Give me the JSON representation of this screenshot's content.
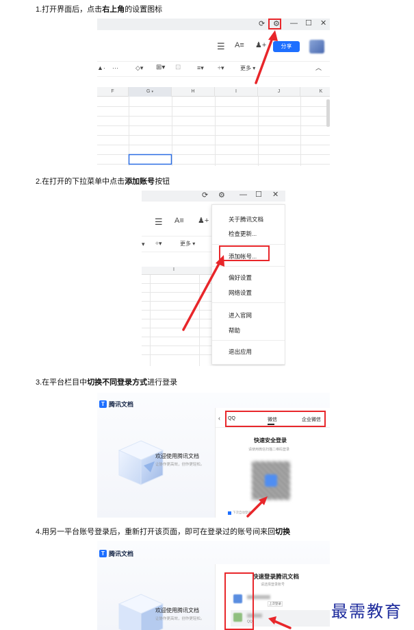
{
  "steps": [
    {
      "pre": "1.打开界面后，点击",
      "bold": "右上角",
      "post": "的设置图标"
    },
    {
      "pre": "2.在打开的下拉菜单中点击",
      "bold": "添加账号",
      "post": "按钮"
    },
    {
      "pre": "3.在平台栏目中",
      "bold": "切换不同登录方式",
      "post": "进行登录"
    },
    {
      "pre": "4.用另一平台账号登录后，重新打开该页面，即可在登录过的账号间来回",
      "bold": "切换",
      "post": ""
    }
  ],
  "panel1": {
    "share_label": "分享",
    "more_label": "更多",
    "columns": [
      "F",
      "G",
      "H",
      "I",
      "J",
      "K"
    ]
  },
  "panel2": {
    "more_label": "更多",
    "col_label": "I",
    "menu_items": [
      "关于腾讯文档",
      "检查更新...",
      "添加帐号...",
      "偏好设置",
      "网络设置",
      "进入官网",
      "帮助",
      "退出应用"
    ]
  },
  "panel3": {
    "app_name": "腾讯文档",
    "welcome": "欢迎使用腾讯文档",
    "welcome_sub": "让协作更高效，创作更轻松。",
    "tabs": [
      "QQ",
      "微信",
      "企业微信"
    ],
    "login_title": "快速安全登录",
    "login_sub": "请使用微信扫描二维码登录",
    "remember": "下次自动登录"
  },
  "panel4": {
    "app_name": "腾讯文档",
    "welcome": "欢迎使用腾讯文档",
    "welcome_sub": "让协作更高效，创作更轻松。",
    "quick_title": "快速登录腾讯文档",
    "quick_sub": "请选择登录账号",
    "last_tag": "上次登录",
    "account_type": "QQ"
  },
  "watermark": "最需教育",
  "colors": {
    "accent": "#1e6fff",
    "highlight": "#e8262a",
    "watermark": "#1c2a9c"
  }
}
